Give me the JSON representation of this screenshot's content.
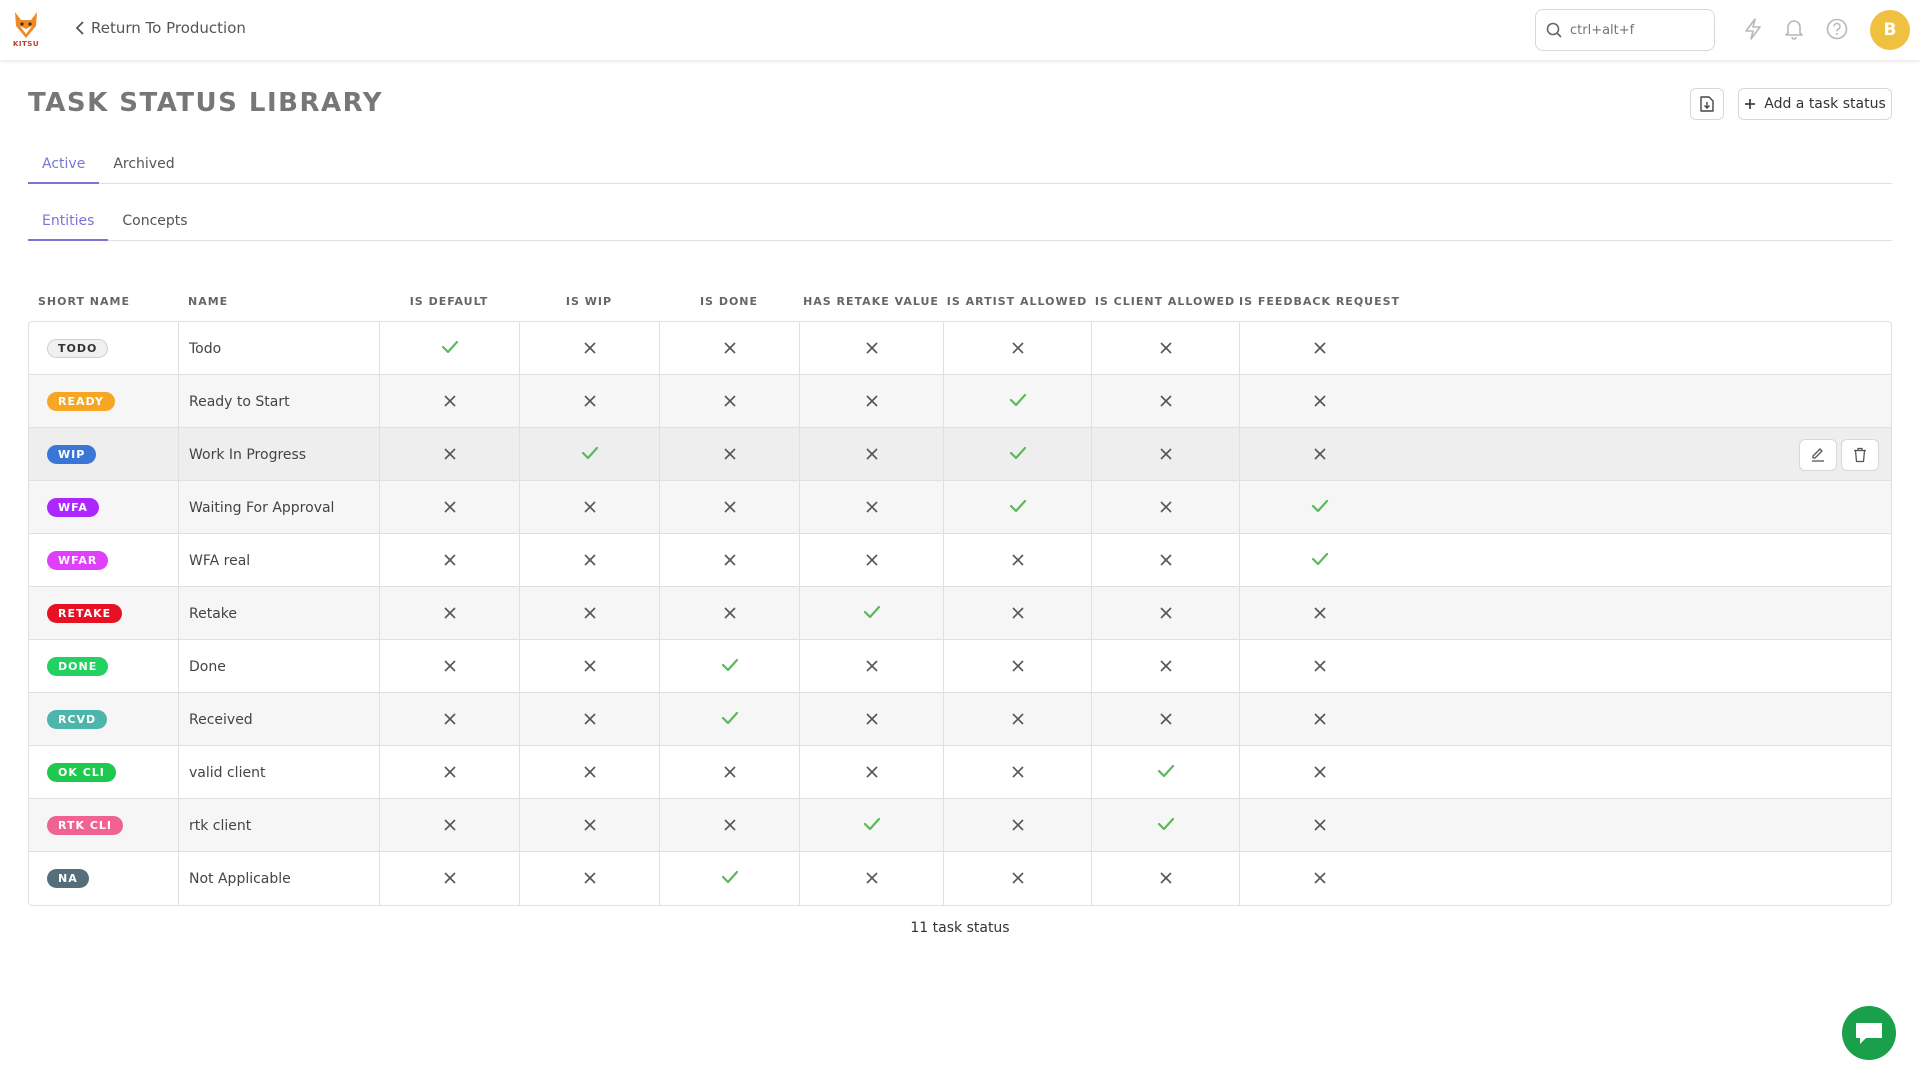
{
  "app": {
    "logo_text": "KITSU",
    "back_label": "Return To Production",
    "search_value": "ctrl+alt+f",
    "avatar_initial": "B"
  },
  "page": {
    "title": "TASK STATUS LIBRARY",
    "add_button_label": "Add a task status",
    "tabs": [
      {
        "label": "Active",
        "active": true
      },
      {
        "label": "Archived",
        "active": false
      }
    ],
    "subtabs": [
      {
        "label": "Entities",
        "active": true
      },
      {
        "label": "Concepts",
        "active": false
      }
    ],
    "footer_count": "11 task status"
  },
  "table": {
    "columns": [
      "SHORT NAME",
      "NAME",
      "IS DEFAULT",
      "IS WIP",
      "IS DONE",
      "HAS RETAKE VALUE",
      "IS ARTIST ALLOWED",
      "IS CLIENT ALLOWED",
      "IS FEEDBACK REQUEST"
    ],
    "rows": [
      {
        "short": "TODO",
        "name": "Todo",
        "color": "#f0f0f0",
        "text_color": "#333333",
        "flags": [
          true,
          false,
          false,
          false,
          false,
          false,
          false
        ]
      },
      {
        "short": "READY",
        "name": "Ready to Start",
        "color": "#f5a623",
        "text_color": "#ffffff",
        "flags": [
          false,
          false,
          false,
          false,
          true,
          false,
          false
        ]
      },
      {
        "short": "WIP",
        "name": "Work In Progress",
        "color": "#3a76d8",
        "text_color": "#ffffff",
        "flags": [
          false,
          true,
          false,
          false,
          true,
          false,
          false
        ]
      },
      {
        "short": "WFA",
        "name": "Waiting For Approval",
        "color": "#ab26ff",
        "text_color": "#ffffff",
        "flags": [
          false,
          false,
          false,
          false,
          true,
          false,
          true
        ]
      },
      {
        "short": "WFAR",
        "name": "WFA real",
        "color": "#e040fb",
        "text_color": "#ffffff",
        "flags": [
          false,
          false,
          false,
          false,
          false,
          false,
          true
        ]
      },
      {
        "short": "RETAKE",
        "name": "Retake",
        "color": "#e81123",
        "text_color": "#ffffff",
        "flags": [
          false,
          false,
          false,
          true,
          false,
          false,
          false
        ]
      },
      {
        "short": "DONE",
        "name": "Done",
        "color": "#22d160",
        "text_color": "#ffffff",
        "flags": [
          false,
          false,
          true,
          false,
          false,
          false,
          false
        ]
      },
      {
        "short": "RCVD",
        "name": "Received",
        "color": "#4db6ac",
        "text_color": "#ffffff",
        "flags": [
          false,
          false,
          true,
          false,
          false,
          false,
          false
        ]
      },
      {
        "short": "OK CLI",
        "name": "valid client",
        "color": "#1ec94e",
        "text_color": "#ffffff",
        "flags": [
          false,
          false,
          false,
          false,
          false,
          true,
          false
        ]
      },
      {
        "short": "RTK CLI",
        "name": "rtk client",
        "color": "#f06292",
        "text_color": "#ffffff",
        "flags": [
          false,
          false,
          false,
          true,
          false,
          true,
          false
        ]
      },
      {
        "short": "NA",
        "name": "Not Applicable",
        "color": "#546e7a",
        "text_color": "#ffffff",
        "flags": [
          false,
          false,
          true,
          false,
          false,
          false,
          false
        ]
      }
    ],
    "hover_row_index": 2
  },
  "colors": {
    "accent": "#7b75d6",
    "check": "#5cb85c",
    "cross": "#555555",
    "chat": "#1aa04a"
  },
  "icons": {
    "back": "chevron-left-icon",
    "search": "search-icon",
    "notifications": "bell-icon",
    "news": "lightning-icon",
    "help": "help-icon",
    "export": "file-download-icon",
    "add": "plus-icon",
    "edit": "edit-icon",
    "delete": "trash-icon",
    "chat": "chat-icon"
  }
}
